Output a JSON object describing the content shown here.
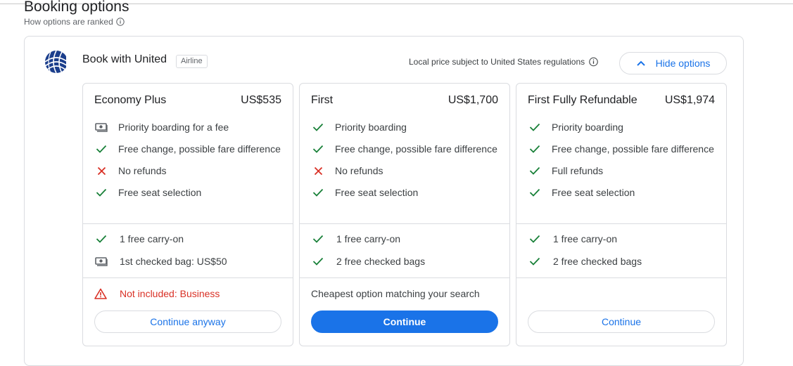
{
  "section": {
    "title": "Booking options",
    "ranking_link": "How options are ranked"
  },
  "provider": {
    "name": "Book with United",
    "badge": "Airline",
    "regulation_note": "Local price subject to United States regulations",
    "hide_button": "Hide options"
  },
  "colors": {
    "accent": "#1a73e8",
    "check": "#188038",
    "cross": "#d93025",
    "warning": "#d93025"
  },
  "options": [
    {
      "name": "Economy Plus",
      "price": "US$535",
      "features": [
        {
          "icon": "money-icon",
          "text": "Priority boarding for a fee"
        },
        {
          "icon": "check-icon",
          "text": "Free change, possible fare difference"
        },
        {
          "icon": "cross-icon",
          "text": "No refunds"
        },
        {
          "icon": "check-icon",
          "text": "Free seat selection"
        }
      ],
      "bags": [
        {
          "icon": "check-icon",
          "text": "1 free carry-on"
        },
        {
          "icon": "money-icon",
          "text": "1st checked bag: US$50"
        }
      ],
      "note": "Not included: Business",
      "note_icon": "warning-icon",
      "button": "Continue anyway"
    },
    {
      "name": "First",
      "price": "US$1,700",
      "features": [
        {
          "icon": "check-icon",
          "text": "Priority boarding"
        },
        {
          "icon": "check-icon",
          "text": "Free change, possible fare difference"
        },
        {
          "icon": "cross-icon",
          "text": "No refunds"
        },
        {
          "icon": "check-icon",
          "text": "Free seat selection"
        }
      ],
      "bags": [
        {
          "icon": "check-icon",
          "text": "1 free carry-on"
        },
        {
          "icon": "check-icon",
          "text": "2 free checked bags"
        }
      ],
      "note": "Cheapest option matching your search",
      "button": "Continue"
    },
    {
      "name": "First Fully Refundable",
      "price": "US$1,974",
      "features": [
        {
          "icon": "check-icon",
          "text": "Priority boarding"
        },
        {
          "icon": "check-icon",
          "text": "Free change, possible fare difference"
        },
        {
          "icon": "check-icon",
          "text": "Full refunds"
        },
        {
          "icon": "check-icon",
          "text": "Free seat selection"
        }
      ],
      "bags": [
        {
          "icon": "check-icon",
          "text": "1 free carry-on"
        },
        {
          "icon": "check-icon",
          "text": "2 free checked bags"
        }
      ],
      "note": "",
      "button": "Continue"
    }
  ]
}
